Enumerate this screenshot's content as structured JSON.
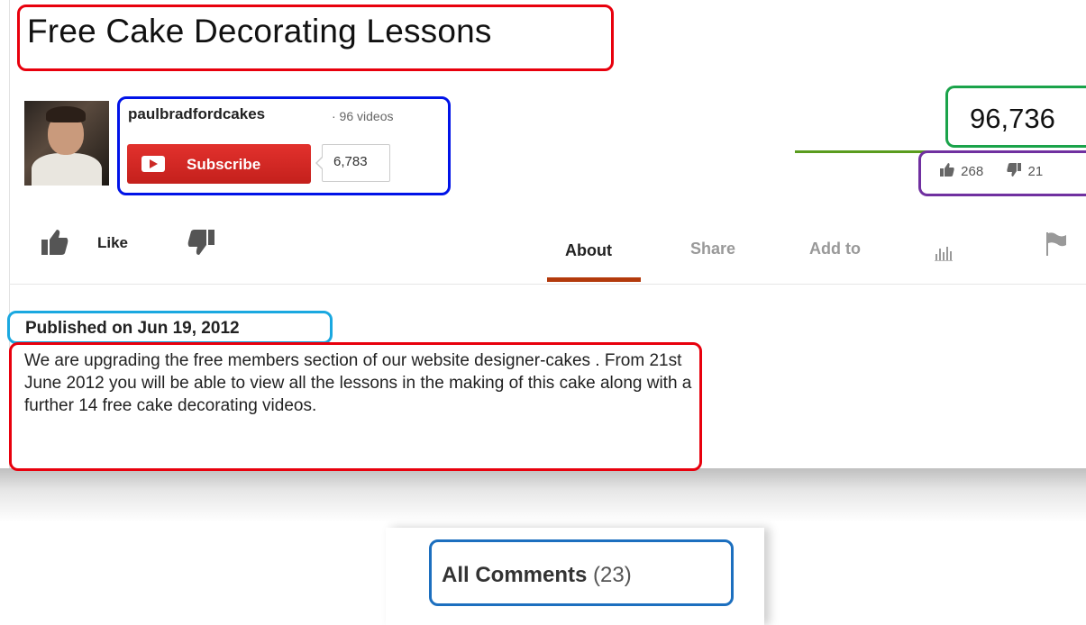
{
  "video": {
    "title": "Free Cake Decorating Lessons",
    "channel_name": "paulbradfordcakes",
    "video_count": "· 96 videos",
    "subscribe_label": "Subscribe",
    "subscriber_count": "6,783",
    "view_count": "96,736",
    "like_count": "268",
    "dislike_count": "21",
    "like_ratio": 0.93
  },
  "actions": {
    "like_label": "Like",
    "tabs": [
      "About",
      "Share",
      "Add to"
    ],
    "active_tab": "About"
  },
  "description": {
    "published": "Published on Jun 19, 2012",
    "text": "We are upgrading the free members section of our website designer-cakes . From 21st June 2012 you will be able to view all the lessons in the making of this cake along with a further 14 free cake decorating videos."
  },
  "comments": {
    "label": "All Comments",
    "count": "(23)"
  },
  "icons": [
    "like-thumb-icon",
    "dislike-thumb-icon",
    "youtube-play-icon",
    "stats-icon",
    "flag-icon"
  ],
  "colors": {
    "subscribe_red": "#cc2a25",
    "active_tab_underline": "#b33a0c",
    "ratio_bar_green": "#5a9c1e",
    "annotation_red": "#e8000d",
    "annotation_blue": "#0013e8",
    "annotation_green": "#1aa34a",
    "annotation_purple": "#7030a0",
    "annotation_cyan": "#1aa8e0",
    "annotation_steel_blue": "#1c6fbf"
  }
}
